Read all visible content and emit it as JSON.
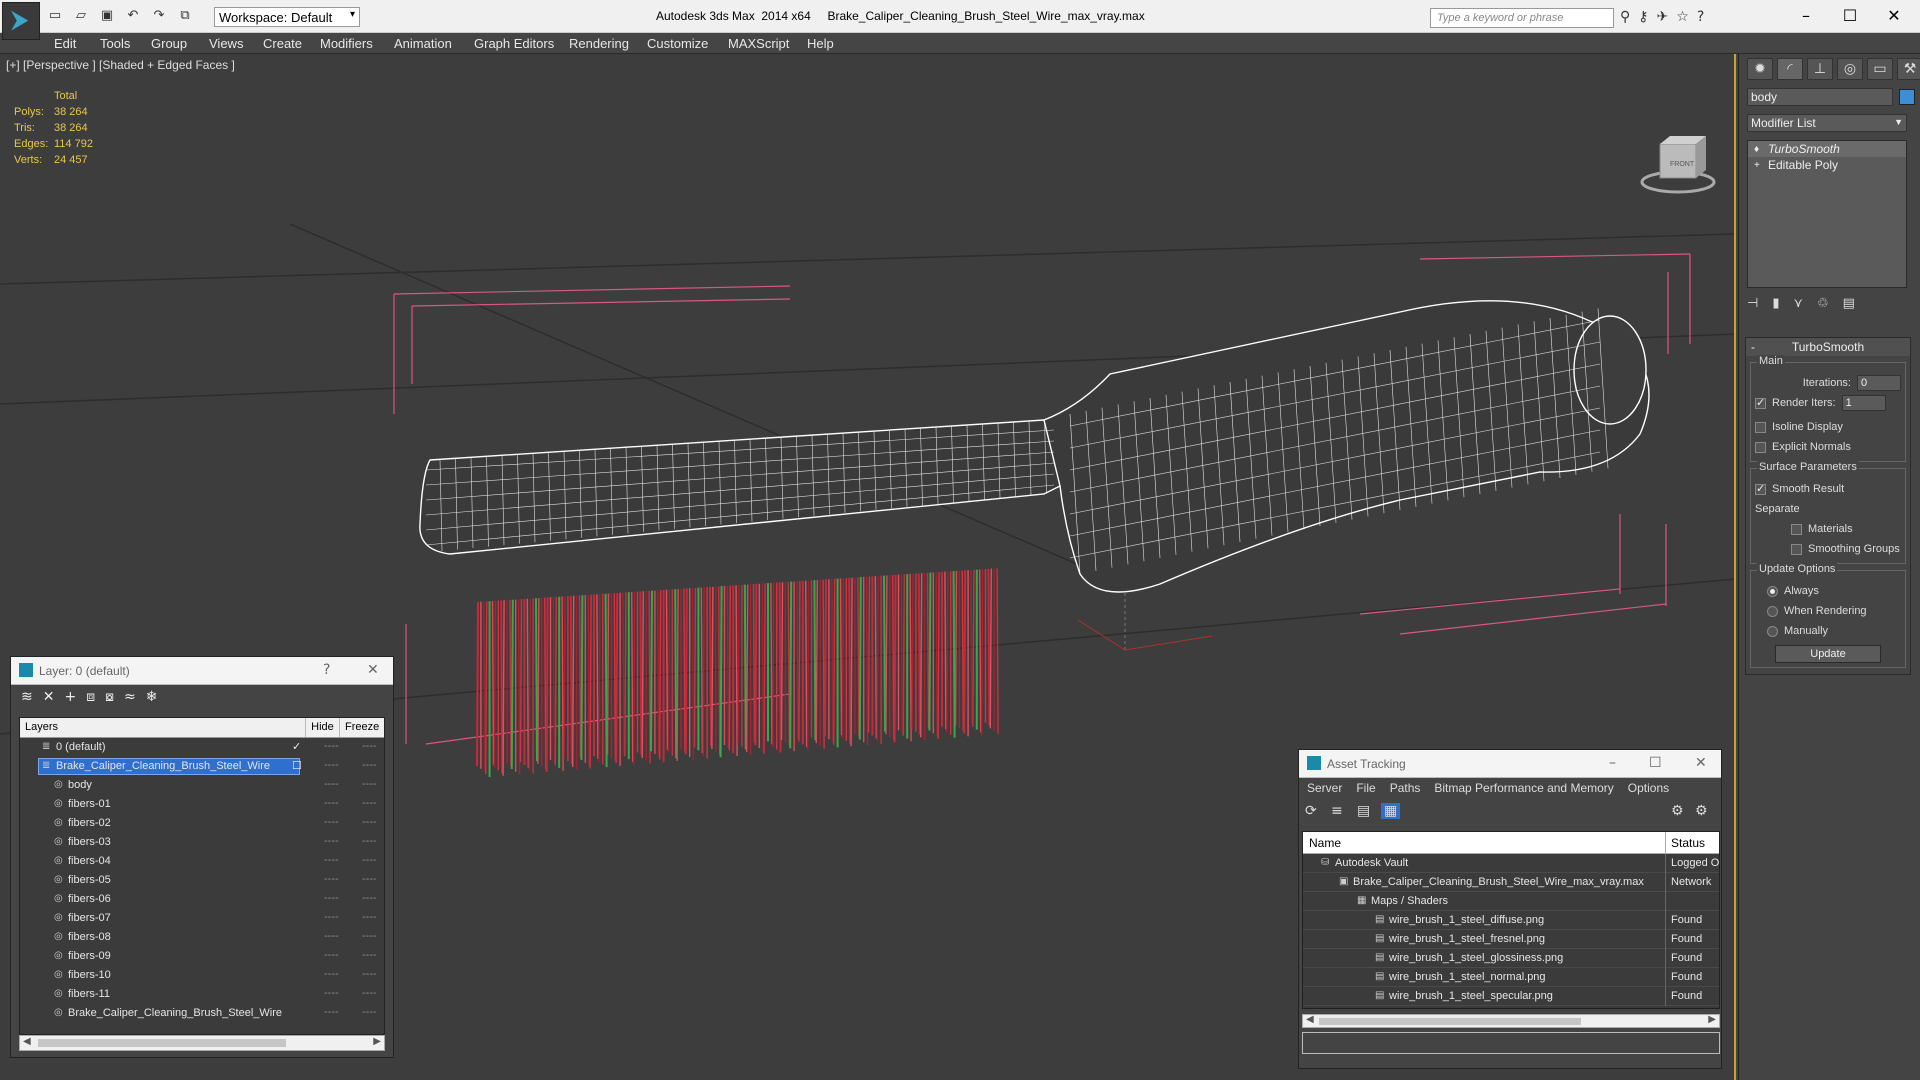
{
  "titlebar": {
    "workspace": "Workspace: Default",
    "app_title": "Autodesk 3ds Max  2014 x64",
    "file_title": "Brake_Caliper_Cleaning_Brush_Steel_Wire_max_vray.max",
    "search_placeholder": "Type a keyword or phrase"
  },
  "menu": [
    "Edit",
    "Tools",
    "Group",
    "Views",
    "Create",
    "Modifiers",
    "Animation",
    "Graph Editors",
    "Rendering",
    "Customize",
    "MAXScript",
    "Help"
  ],
  "viewport": {
    "label": "[+] [Perspective ] [Shaded + Edged Faces ]",
    "stats": {
      "header": "Total",
      "rows": [
        {
          "k": "Polys:",
          "v": "38 264"
        },
        {
          "k": "Tris:",
          "v": "38 264"
        },
        {
          "k": "Edges:",
          "v": "114 792"
        },
        {
          "k": "Verts:",
          "v": "24 457"
        }
      ]
    },
    "viewcube_label": "FRONT"
  },
  "command_panel": {
    "object_name": "body",
    "object_color": "#3a8fd8",
    "modifier_list": "Modifier List",
    "stack": [
      "TurboSmooth",
      "Editable Poly"
    ],
    "rollout_title": "TurboSmooth",
    "main_label": "Main",
    "iterations_label": "Iterations:",
    "iterations_value": "0",
    "render_iters_label": "Render Iters:",
    "render_iters_value": "1",
    "isoline_label": "Isoline Display",
    "explicit_normals_label": "Explicit Normals",
    "surface_params_label": "Surface Parameters",
    "smooth_result_label": "Smooth Result",
    "separate_label": "Separate",
    "materials_label": "Materials",
    "smoothing_groups_label": "Smoothing Groups",
    "update_options_label": "Update Options",
    "always_label": "Always",
    "when_rendering_label": "When Rendering",
    "manually_label": "Manually",
    "update_button": "Update"
  },
  "layers_window": {
    "title": "Layer: 0 (default)",
    "col_layers": "Layers",
    "col_hide": "Hide",
    "col_freeze": "Freeze",
    "rows": [
      {
        "name": "0 (default)",
        "level": 0
      },
      {
        "name": "Brake_Caliper_Cleaning_Brush_Steel_Wire",
        "level": 0,
        "selected": true
      },
      {
        "name": "body",
        "level": 1
      },
      {
        "name": "fibers-01",
        "level": 1
      },
      {
        "name": "fibers-02",
        "level": 1
      },
      {
        "name": "fibers-03",
        "level": 1
      },
      {
        "name": "fibers-04",
        "level": 1
      },
      {
        "name": "fibers-05",
        "level": 1
      },
      {
        "name": "fibers-06",
        "level": 1
      },
      {
        "name": "fibers-07",
        "level": 1
      },
      {
        "name": "fibers-08",
        "level": 1
      },
      {
        "name": "fibers-09",
        "level": 1
      },
      {
        "name": "fibers-10",
        "level": 1
      },
      {
        "name": "fibers-11",
        "level": 1
      },
      {
        "name": "Brake_Caliper_Cleaning_Brush_Steel_Wire",
        "level": 1
      }
    ],
    "dash": "----"
  },
  "asset_window": {
    "title": "Asset Tracking",
    "menu": [
      "Server",
      "File",
      "Paths",
      "Bitmap Performance and Memory",
      "Options"
    ],
    "col_name": "Name",
    "col_status": "Status",
    "rows": [
      {
        "name": "Autodesk Vault",
        "status": "Logged O",
        "level": 1
      },
      {
        "name": "Brake_Caliper_Cleaning_Brush_Steel_Wire_max_vray.max",
        "status": "Network",
        "level": 2
      },
      {
        "name": "Maps / Shaders",
        "status": "",
        "level": 3
      },
      {
        "name": "wire_brush_1_steel_diffuse.png",
        "status": "Found",
        "level": 4
      },
      {
        "name": "wire_brush_1_steel_fresnel.png",
        "status": "Found",
        "level": 4
      },
      {
        "name": "wire_brush_1_steel_glossiness.png",
        "status": "Found",
        "level": 4
      },
      {
        "name": "wire_brush_1_steel_normal.png",
        "status": "Found",
        "level": 4
      },
      {
        "name": "wire_brush_1_steel_specular.png",
        "status": "Found",
        "level": 4
      }
    ]
  }
}
